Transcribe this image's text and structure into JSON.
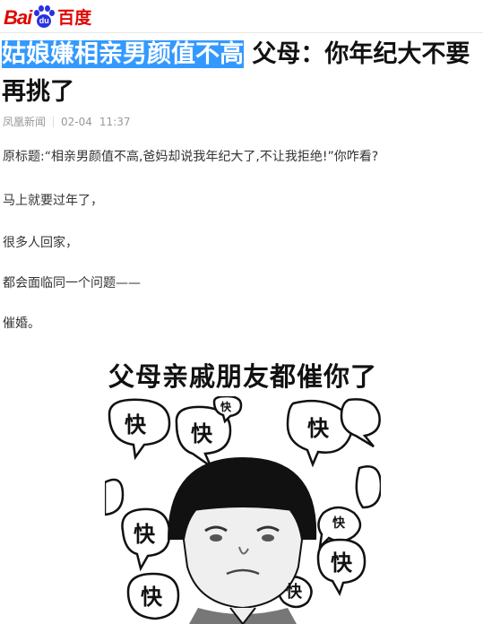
{
  "logo": {
    "left": "Bai",
    "mark": "du",
    "right": "百度"
  },
  "article": {
    "headline_highlight": "姑娘嫌相亲男颜值不高",
    "headline_rest": " 父母：你年纪大不要再挑了",
    "source": "凤凰新闻",
    "date": "02-04",
    "time": "11:37",
    "paragraphs": [
      "原标题:“相亲男颜值不高,爸妈却说我年纪大了,不让我拒绝!”你咋看?",
      "马上就要过年了，",
      "很多人回家，",
      "都会面临同一个问题——",
      "催婚。"
    ]
  },
  "meme": {
    "title": "父母亲戚朋友都催你了",
    "bubble_word": "快"
  }
}
